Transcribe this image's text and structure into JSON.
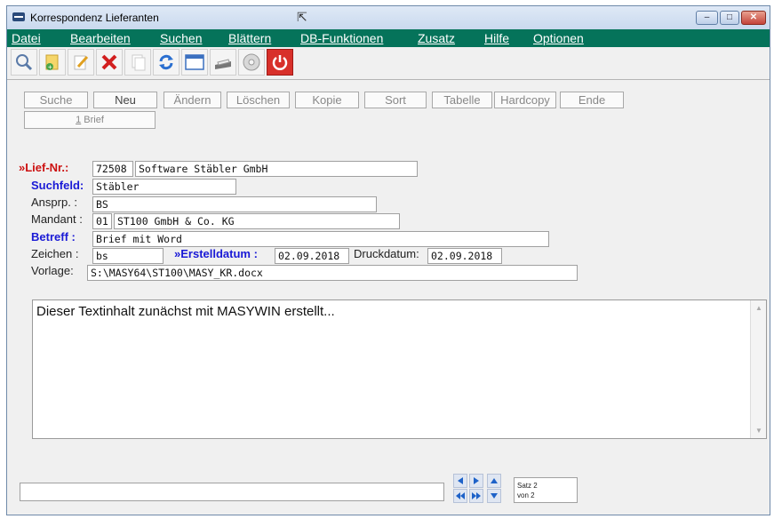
{
  "window": {
    "title": "Korrespondenz Lieferanten"
  },
  "menu": [
    "Datei",
    "Bearbeiten",
    "Suchen",
    "Blättern",
    "DB-Funktionen",
    "Zusatz",
    "Hilfe",
    "Optionen"
  ],
  "toolbar_icons": [
    "search-icon",
    "new-document-icon",
    "edit-icon",
    "delete-icon",
    "copy-icon",
    "refresh-icon",
    "window-icon",
    "printer-icon",
    "cd-icon",
    "power-icon"
  ],
  "tabs": [
    "Suche",
    "Neu",
    "Ändern",
    "Löschen",
    "Kopie",
    "Sort",
    "Tabelle",
    "Hardcopy",
    "Ende"
  ],
  "subtab": {
    "num": "1",
    "label": " Brief"
  },
  "form": {
    "lief_nr_label": "»Lief-Nr.:",
    "lief_nr": "72508",
    "lief_name": "Software Stäbler GmbH",
    "suchfeld_label": "Suchfeld:",
    "suchfeld": "Stäbler",
    "ansprp_label": "Ansprp. :",
    "ansprp": "BS",
    "mandant_label": "Mandant :",
    "mandant_nr": "01",
    "mandant_name": "ST100 GmbH & Co. KG",
    "betreff_label": "Betreff :",
    "betreff": "Brief mit Word",
    "zeichen_label": "Zeichen :",
    "zeichen": "bs",
    "erstelldatum_label": "»Erstelldatum :",
    "erstelldatum": "02.09.2018",
    "druckdatum_label": "Druckdatum:",
    "druckdatum": "02.09.2018",
    "vorlage_label": "Vorlage:",
    "vorlage": "S:\\MASY64\\ST100\\MASY_KR.docx"
  },
  "text_content": "Dieser Textinhalt zunächst mit MASYWIN erstellt...",
  "status": {
    "satz": "Satz 2",
    "von": "von 2"
  },
  "colors": {
    "menubar": "#05735a",
    "label_red": "#cc1111",
    "label_blue": "#1a1ad6",
    "nav_arrow": "#1e62c8"
  }
}
